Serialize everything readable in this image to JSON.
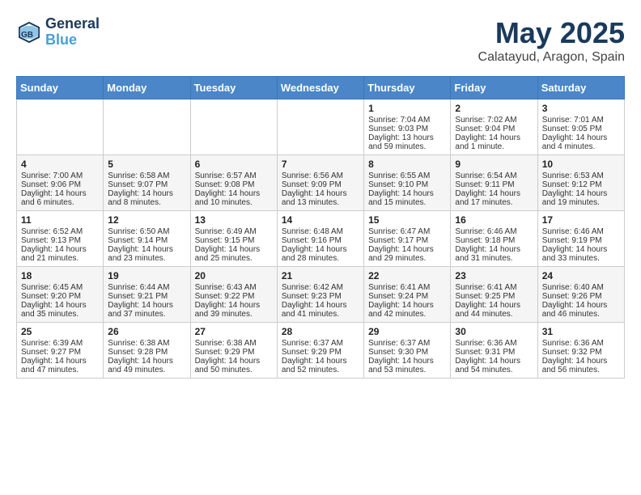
{
  "header": {
    "logo_line1": "General",
    "logo_line2": "Blue",
    "month_title": "May 2025",
    "location": "Calatayud, Aragon, Spain"
  },
  "days_of_week": [
    "Sunday",
    "Monday",
    "Tuesday",
    "Wednesday",
    "Thursday",
    "Friday",
    "Saturday"
  ],
  "weeks": [
    [
      {
        "day": "",
        "sunrise": "",
        "sunset": "",
        "daylight": ""
      },
      {
        "day": "",
        "sunrise": "",
        "sunset": "",
        "daylight": ""
      },
      {
        "day": "",
        "sunrise": "",
        "sunset": "",
        "daylight": ""
      },
      {
        "day": "",
        "sunrise": "",
        "sunset": "",
        "daylight": ""
      },
      {
        "day": "1",
        "sunrise": "Sunrise: 7:04 AM",
        "sunset": "Sunset: 9:03 PM",
        "daylight": "Daylight: 13 hours and 59 minutes."
      },
      {
        "day": "2",
        "sunrise": "Sunrise: 7:02 AM",
        "sunset": "Sunset: 9:04 PM",
        "daylight": "Daylight: 14 hours and 1 minute."
      },
      {
        "day": "3",
        "sunrise": "Sunrise: 7:01 AM",
        "sunset": "Sunset: 9:05 PM",
        "daylight": "Daylight: 14 hours and 4 minutes."
      }
    ],
    [
      {
        "day": "4",
        "sunrise": "Sunrise: 7:00 AM",
        "sunset": "Sunset: 9:06 PM",
        "daylight": "Daylight: 14 hours and 6 minutes."
      },
      {
        "day": "5",
        "sunrise": "Sunrise: 6:58 AM",
        "sunset": "Sunset: 9:07 PM",
        "daylight": "Daylight: 14 hours and 8 minutes."
      },
      {
        "day": "6",
        "sunrise": "Sunrise: 6:57 AM",
        "sunset": "Sunset: 9:08 PM",
        "daylight": "Daylight: 14 hours and 10 minutes."
      },
      {
        "day": "7",
        "sunrise": "Sunrise: 6:56 AM",
        "sunset": "Sunset: 9:09 PM",
        "daylight": "Daylight: 14 hours and 13 minutes."
      },
      {
        "day": "8",
        "sunrise": "Sunrise: 6:55 AM",
        "sunset": "Sunset: 9:10 PM",
        "daylight": "Daylight: 14 hours and 15 minutes."
      },
      {
        "day": "9",
        "sunrise": "Sunrise: 6:54 AM",
        "sunset": "Sunset: 9:11 PM",
        "daylight": "Daylight: 14 hours and 17 minutes."
      },
      {
        "day": "10",
        "sunrise": "Sunrise: 6:53 AM",
        "sunset": "Sunset: 9:12 PM",
        "daylight": "Daylight: 14 hours and 19 minutes."
      }
    ],
    [
      {
        "day": "11",
        "sunrise": "Sunrise: 6:52 AM",
        "sunset": "Sunset: 9:13 PM",
        "daylight": "Daylight: 14 hours and 21 minutes."
      },
      {
        "day": "12",
        "sunrise": "Sunrise: 6:50 AM",
        "sunset": "Sunset: 9:14 PM",
        "daylight": "Daylight: 14 hours and 23 minutes."
      },
      {
        "day": "13",
        "sunrise": "Sunrise: 6:49 AM",
        "sunset": "Sunset: 9:15 PM",
        "daylight": "Daylight: 14 hours and 25 minutes."
      },
      {
        "day": "14",
        "sunrise": "Sunrise: 6:48 AM",
        "sunset": "Sunset: 9:16 PM",
        "daylight": "Daylight: 14 hours and 28 minutes."
      },
      {
        "day": "15",
        "sunrise": "Sunrise: 6:47 AM",
        "sunset": "Sunset: 9:17 PM",
        "daylight": "Daylight: 14 hours and 29 minutes."
      },
      {
        "day": "16",
        "sunrise": "Sunrise: 6:46 AM",
        "sunset": "Sunset: 9:18 PM",
        "daylight": "Daylight: 14 hours and 31 minutes."
      },
      {
        "day": "17",
        "sunrise": "Sunrise: 6:46 AM",
        "sunset": "Sunset: 9:19 PM",
        "daylight": "Daylight: 14 hours and 33 minutes."
      }
    ],
    [
      {
        "day": "18",
        "sunrise": "Sunrise: 6:45 AM",
        "sunset": "Sunset: 9:20 PM",
        "daylight": "Daylight: 14 hours and 35 minutes."
      },
      {
        "day": "19",
        "sunrise": "Sunrise: 6:44 AM",
        "sunset": "Sunset: 9:21 PM",
        "daylight": "Daylight: 14 hours and 37 minutes."
      },
      {
        "day": "20",
        "sunrise": "Sunrise: 6:43 AM",
        "sunset": "Sunset: 9:22 PM",
        "daylight": "Daylight: 14 hours and 39 minutes."
      },
      {
        "day": "21",
        "sunrise": "Sunrise: 6:42 AM",
        "sunset": "Sunset: 9:23 PM",
        "daylight": "Daylight: 14 hours and 41 minutes."
      },
      {
        "day": "22",
        "sunrise": "Sunrise: 6:41 AM",
        "sunset": "Sunset: 9:24 PM",
        "daylight": "Daylight: 14 hours and 42 minutes."
      },
      {
        "day": "23",
        "sunrise": "Sunrise: 6:41 AM",
        "sunset": "Sunset: 9:25 PM",
        "daylight": "Daylight: 14 hours and 44 minutes."
      },
      {
        "day": "24",
        "sunrise": "Sunrise: 6:40 AM",
        "sunset": "Sunset: 9:26 PM",
        "daylight": "Daylight: 14 hours and 46 minutes."
      }
    ],
    [
      {
        "day": "25",
        "sunrise": "Sunrise: 6:39 AM",
        "sunset": "Sunset: 9:27 PM",
        "daylight": "Daylight: 14 hours and 47 minutes."
      },
      {
        "day": "26",
        "sunrise": "Sunrise: 6:38 AM",
        "sunset": "Sunset: 9:28 PM",
        "daylight": "Daylight: 14 hours and 49 minutes."
      },
      {
        "day": "27",
        "sunrise": "Sunrise: 6:38 AM",
        "sunset": "Sunset: 9:29 PM",
        "daylight": "Daylight: 14 hours and 50 minutes."
      },
      {
        "day": "28",
        "sunrise": "Sunrise: 6:37 AM",
        "sunset": "Sunset: 9:29 PM",
        "daylight": "Daylight: 14 hours and 52 minutes."
      },
      {
        "day": "29",
        "sunrise": "Sunrise: 6:37 AM",
        "sunset": "Sunset: 9:30 PM",
        "daylight": "Daylight: 14 hours and 53 minutes."
      },
      {
        "day": "30",
        "sunrise": "Sunrise: 6:36 AM",
        "sunset": "Sunset: 9:31 PM",
        "daylight": "Daylight: 14 hours and 54 minutes."
      },
      {
        "day": "31",
        "sunrise": "Sunrise: 6:36 AM",
        "sunset": "Sunset: 9:32 PM",
        "daylight": "Daylight: 14 hours and 56 minutes."
      }
    ]
  ]
}
